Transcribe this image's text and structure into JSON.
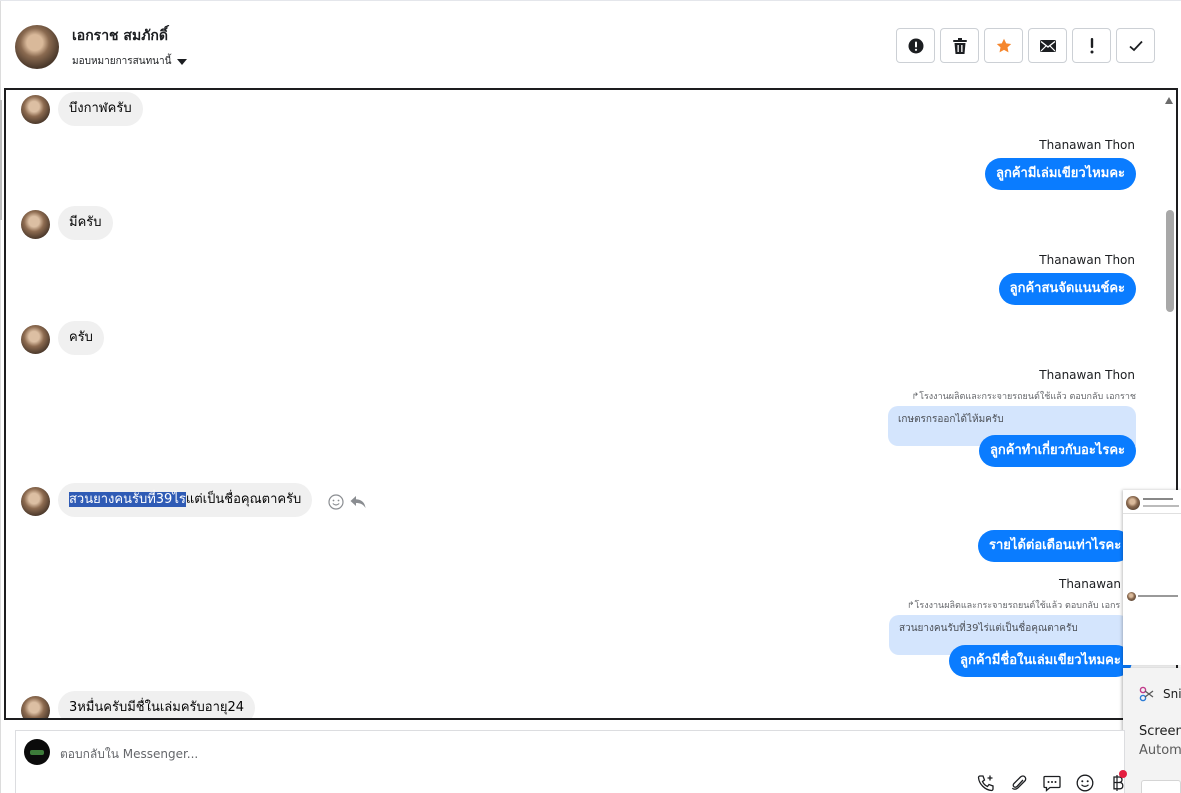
{
  "header": {
    "contact_name": "เอกราช สมภักดิ์",
    "assign_label": "มอบหมายการสนทนานี้",
    "actions": [
      {
        "name": "report-button",
        "icon": "alert-circle-icon"
      },
      {
        "name": "delete-button",
        "icon": "trash-icon"
      },
      {
        "name": "star-button",
        "icon": "star-icon"
      },
      {
        "name": "mark-unread-button",
        "icon": "envelope-icon"
      },
      {
        "name": "important-button",
        "icon": "exclamation-icon"
      },
      {
        "name": "done-button",
        "icon": "check-icon"
      }
    ]
  },
  "thread": {
    "messages": [
      {
        "dir": "in",
        "text": "บึงกาฬครับ"
      },
      {
        "dir": "out",
        "sender": "Thanawan Thon",
        "text": "ลูกค้ามีเล่มเขียวไหมคะ"
      },
      {
        "dir": "in",
        "text": "มีครับ"
      },
      {
        "dir": "out",
        "sender": "Thanawan Thon",
        "text": "ลูกค้าสนจัดแนนช์คะ"
      },
      {
        "dir": "in",
        "text": "ครับ"
      },
      {
        "dir": "out",
        "sender": "Thanawan Thon",
        "reply_meta": "โรงงานผลิตและกระจายรถยนต์ใช้แล้ว ตอบกลับ เอกราช",
        "quoted": "เกษตรกรออกได้ไห้มครับ",
        "text": "ลูกค้าทำเกี่ยวกับอะไรคะ"
      },
      {
        "dir": "in",
        "text_selected": "สวนยางคนรับที่39ไร",
        "text_rest": "แต่เป็นชื่อคุณตาครับ"
      },
      {
        "dir": "out",
        "text": "รายได้ต่อเดือนเท่าไรคะ"
      },
      {
        "dir": "out",
        "sender": "Thanawan Tho",
        "reply_meta": "โรงงานผลิตและกระจายรถยนต์ใช้แล้ว ตอบกลับ เอกร",
        "quoted": "สวนยางคนรับที่39ไร่แต่เป็นชื่อคุณตาครับ",
        "text": "ลูกค้ามีชื่อในเล่มเขียวไหมคะ"
      },
      {
        "dir": "in",
        "text": "3หมื่นครับมีชื่ในเล่มครับอายุ24"
      }
    ]
  },
  "composer": {
    "placeholder": "ตอบกลับใน Messenger..."
  },
  "side_popup": {
    "snip_title": "Snip",
    "line1": "Screen",
    "line2": "Autom"
  },
  "colors": {
    "outgoing_bubble": "#0a7cff",
    "incoming_bubble": "#f0f0f0",
    "quoted_bubble": "#d4e5fd",
    "star": "#f5862d"
  }
}
